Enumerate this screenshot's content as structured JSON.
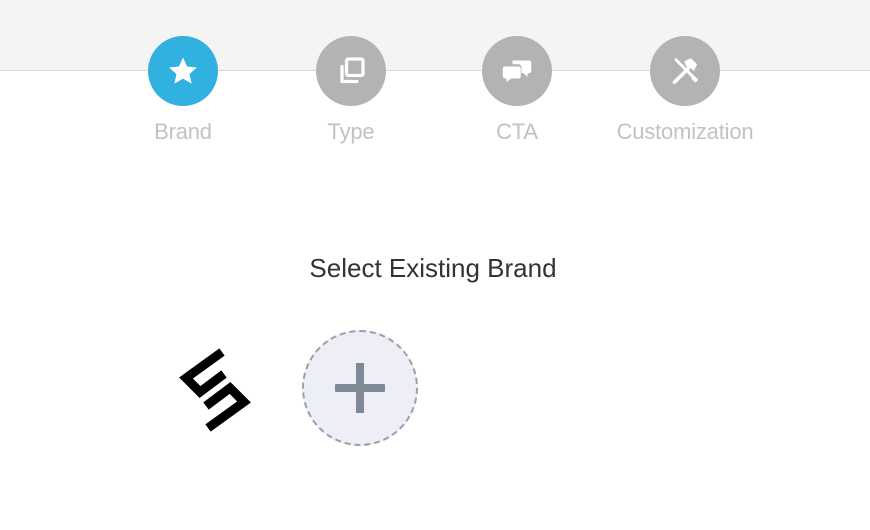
{
  "colors": {
    "active_step": "#31b1e0",
    "inactive_step": "#b3b3b3",
    "label": "#c2c2c2",
    "title": "#333333",
    "add_bg": "#eeeff6",
    "add_border": "#9aa0aa",
    "add_plus": "#7f8895"
  },
  "wizard": {
    "steps": [
      {
        "label": "Brand",
        "icon": "star-icon",
        "active": true
      },
      {
        "label": "Type",
        "icon": "copy-icon",
        "active": false
      },
      {
        "label": "CTA",
        "icon": "chat-bubbles-icon",
        "active": false
      },
      {
        "label": "Customization",
        "icon": "tools-icon",
        "active": false
      }
    ]
  },
  "main": {
    "title": "Select Existing Brand",
    "brands": [
      {
        "icon": "brand-logo-icon"
      }
    ],
    "add_brand_icon": "plus-icon"
  }
}
